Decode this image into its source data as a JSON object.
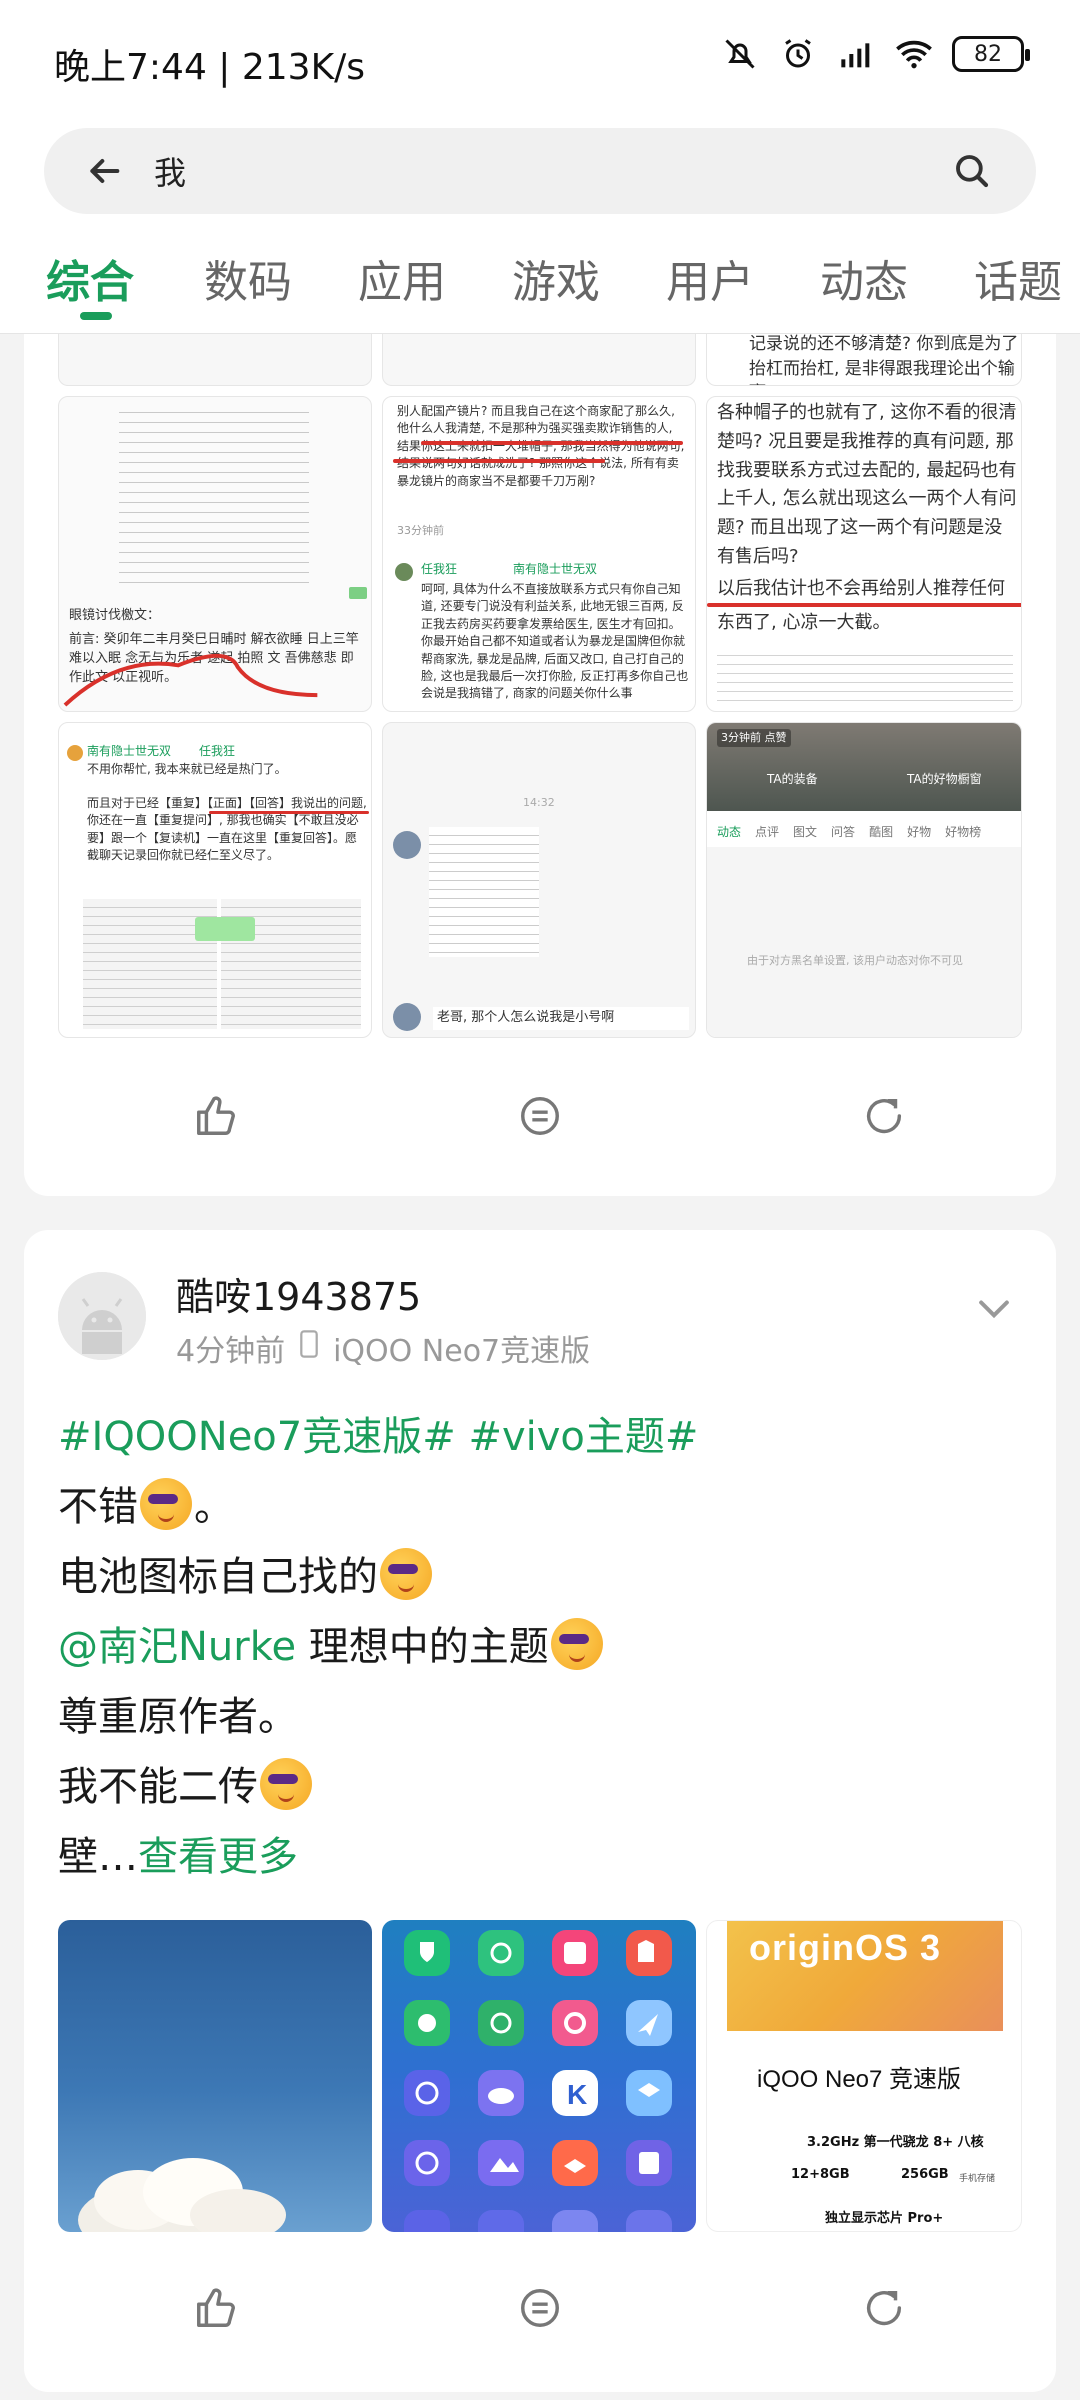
{
  "status_bar": {
    "time": "晚上7:44 | 213K/s",
    "battery": "82",
    "icons": [
      "mute-bell-icon",
      "alarm-icon",
      "hd-signal-icon",
      "wifi-icon",
      "battery-icon"
    ]
  },
  "search": {
    "query": "我",
    "back_icon": "back-arrow-icon",
    "search_icon": "search-icon"
  },
  "tabs": [
    {
      "label": "综合",
      "active": true
    },
    {
      "label": "数码",
      "active": false
    },
    {
      "label": "应用",
      "active": false
    },
    {
      "label": "游戏",
      "active": false
    },
    {
      "label": "用户",
      "active": false
    },
    {
      "label": "动态",
      "active": false
    },
    {
      "label": "话题",
      "active": false
    }
  ],
  "colors": {
    "accent": "#1a9d5b",
    "annotation_red": "#d9312b",
    "muted": "#999999"
  },
  "card1": {
    "grid": {
      "c1_top_caption": "眼镜讨伐檄文：",
      "c1_body": "前言: 癸卯年二丰月癸巳日晡时 解衣欲睡 日上三竿 难以入眠 念无与为乐者 遂起 拍照 文 吾佛慈悲 即作此文 以正视听。",
      "c2_body": "别人配国产镜片? 而且我自己在这个商家配了那么久, 他什么人我清楚, 不是那种为强买强卖欺诈销售的人, 结果你这上来就扣一大堆帽子, 那我当然得为他说两句, 结果说两句好话就成洗了? 那照你这个说法, 所有有卖暴龙镜片的商家当不是都要千刀万剐?",
      "c2_time": "33分钟前",
      "c2_reply_user": "任我狂",
      "c2_reply_to": "南有隐士世无双",
      "c2_reply": "呵呵, 具体为什么不直接放联系方式只有你自己知道, 还要专门说没有利益关系, 此地无银三百两, 反正我去药房买药要拿发票给医生, 医生才有回扣。你最开始自己都不知道或者认为暴龙是国牌但你就帮商家洗, 暴龙是品牌, 后面又改口, 自己打自己的脸, 这也是我最后一次打你脸, 反正打再多你自己也会说是我搞错了, 商家的问题关你什么事",
      "c3_top": "记录说的还不够清楚? 你到底是为了抬杠而抬杠, 是非得跟我理论出个输赢",
      "c3_body": "各种帽子的也就有了, 这你不看的很清楚吗? 况且要是我推荐的真有问题, 那找我要联系方式过去配的, 最起码也有上千人, 怎么就出现这么一两个人有问题? 而且出现了这一两个有问题是没有售后吗?",
      "c3_highlight": "以后我估计也不会再给别人推荐任何",
      "c3_tail": "东西了, 心凉一大截。",
      "c4_user": "南有隐士世无双",
      "c4_reply_to": "任我狂",
      "c4_line1": "不用你帮忙, 我本来就已经是热门了。",
      "c4_body": "而且对于已经【重复】【正面】【回答】我说出的问题, 你还在一直【重复提问】, 那我也确实【不敢且没必要】跟一个【复读机】一直在这里【重复回答】。愿截聊天记录回你就已经仁至义尽了。",
      "c5_time": "14:32",
      "c5_comment": "老哥, 那个人怎么说我是小号啊",
      "c6_time": "3分钟前 点赞",
      "c6_btn1": "TA的装备",
      "c6_btn2": "TA的好物橱窗",
      "c6_tabs": [
        "动态",
        "点评",
        "图文",
        "问答",
        "酷图",
        "好物",
        "好物榜"
      ],
      "c6_notice": "由于对方黑名单设置, 该用户动态对你不可见"
    },
    "actions": {
      "like_icon": "thumbs-up-icon",
      "comment_icon": "comment-icon",
      "share_icon": "share-icon"
    }
  },
  "post": {
    "username": "酷咹1943875",
    "time": "4分钟前",
    "device": "iQOO Neo7竞速版",
    "tags_line": "#IQOONeo7竞速版# #vivo主题#",
    "lines": [
      "不错",
      "。",
      "电池图标自己找的",
      "@南汜Nurke",
      " 理想中的主题",
      "尊重原作者。",
      "我不能二传",
      "壁…",
      "查看更多"
    ],
    "images": {
      "img3_brand": "originOS 3",
      "img3_title": "iQOO Neo7 竞速版",
      "img3_spec1": "3.2GHz 第一代骁龙 8+ 八核",
      "img3_spec2a": "12+8GB",
      "img3_spec2b": "256GB",
      "img3_spec2c": "手机存储",
      "img3_spec3": "独立显示芯片 Pro+"
    },
    "actions": {
      "like_icon": "thumbs-up-icon",
      "comment_icon": "comment-icon",
      "share_icon": "share-icon"
    }
  }
}
